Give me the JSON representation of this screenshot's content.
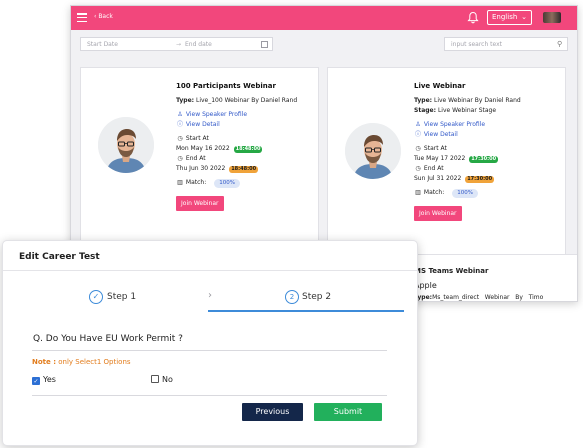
{
  "app": {
    "back_label": "Back",
    "language": "English",
    "filters": {
      "start_date_placeholder": "Start Date",
      "end_date_placeholder": "End date",
      "search_placeholder": "input search text"
    },
    "cards": [
      {
        "title": "100 Participants Webinar",
        "type_label": "Type:",
        "type_value": "Live_100 Webinar By Daniel Rand",
        "view_speaker": "View Speaker Profile",
        "view_detail": "View Detail",
        "start_label": "Start At",
        "start_date": "Mon May 16 2022",
        "start_time": "18:48:00",
        "end_label": "End At",
        "end_date": "Thu Jun 30 2022",
        "end_time": "18:48:00",
        "match_label": "Match:",
        "match_value": "100%",
        "join_label": "Join Webinar"
      },
      {
        "title": "Live Webinar",
        "type_label": "Type:",
        "type_value": "Live Webinar By Daniel Rand",
        "stage_label": "Stage:",
        "stage_value": "Live Webinar Stage",
        "view_speaker": "View Speaker Profile",
        "view_detail": "View Detail",
        "start_label": "Start At",
        "start_date": "Tue May 17 2022",
        "start_time": "17:30:00",
        "end_label": "End At",
        "end_date": "Sun Jul 31 2022",
        "end_time": "17:30:00",
        "match_label": "Match:",
        "match_value": "100%",
        "join_label": "Join Webinar"
      },
      {
        "title": "MS Teams Webinar",
        "subtitle": "Apple",
        "type_label": "Type:",
        "type_value": "Ms_team_direct   Webinar   By   Timo"
      }
    ]
  },
  "modal": {
    "title": "Edit Career Test",
    "step1_label": "Step 1",
    "step2_number": "2",
    "step2_label": "Step 2",
    "question": "Q. Do You Have EU Work Permit ?",
    "note_label": "Note :",
    "note_text": " only Select1 Options",
    "options": [
      {
        "label": "Yes",
        "checked": true
      },
      {
        "label": "No",
        "checked": false
      }
    ],
    "previous_label": "Previous",
    "submit_label": "Submit"
  },
  "colors": {
    "brand_pink": "#f2477c",
    "link_blue": "#3158c8",
    "step_blue": "#3d8bd9",
    "badge_green": "#26a845",
    "badge_orange": "#f0a33a",
    "previous_navy": "#14274a",
    "submit_green": "#22b05c",
    "note_orange": "#e27c1c"
  }
}
